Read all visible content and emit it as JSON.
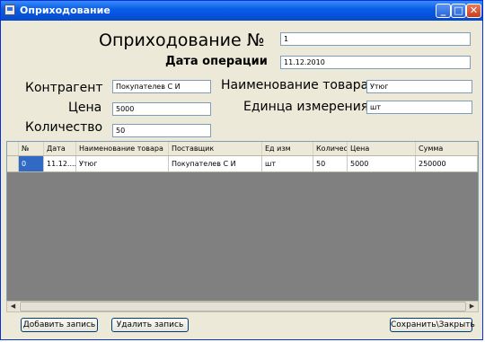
{
  "window": {
    "title": "Оприходование",
    "controls": {
      "minimize": "_",
      "maximize": "□",
      "close": "✕"
    }
  },
  "form": {
    "heading": "Оприходование №",
    "doc_number": "1",
    "date_label": "Дата операции",
    "date_value": "11.12.2010",
    "contractor_label": "Контрагент",
    "contractor_value": "Покупателев С И",
    "product_name_label": "Наименование товара",
    "product_name_value": "Утюг",
    "price_label": "Цена",
    "price_value": "5000",
    "unit_label": "Единца измерения",
    "unit_value": "шт",
    "quantity_label": "Количество",
    "quantity_value": "50"
  },
  "grid": {
    "columns": [
      "№",
      "Дата",
      "Наименование товара",
      "Поставщик",
      "Ед изм",
      "Количес",
      "Цена",
      "Сумма"
    ],
    "rows": [
      [
        "0",
        "11.12....",
        "Утюг",
        "Покупателев С И",
        "шт",
        "50",
        "5000",
        "250000"
      ]
    ]
  },
  "scrollbar": {
    "left_arrow": "◀",
    "right_arrow": "▶"
  },
  "buttons": {
    "add": "Добавить запись",
    "delete": "Удалить запись",
    "save": "Сохранить\\Закрыть"
  },
  "colors": {
    "titlebar": "#0a5ee6",
    "selection": "#316ac5",
    "grid_empty": "#808080"
  }
}
